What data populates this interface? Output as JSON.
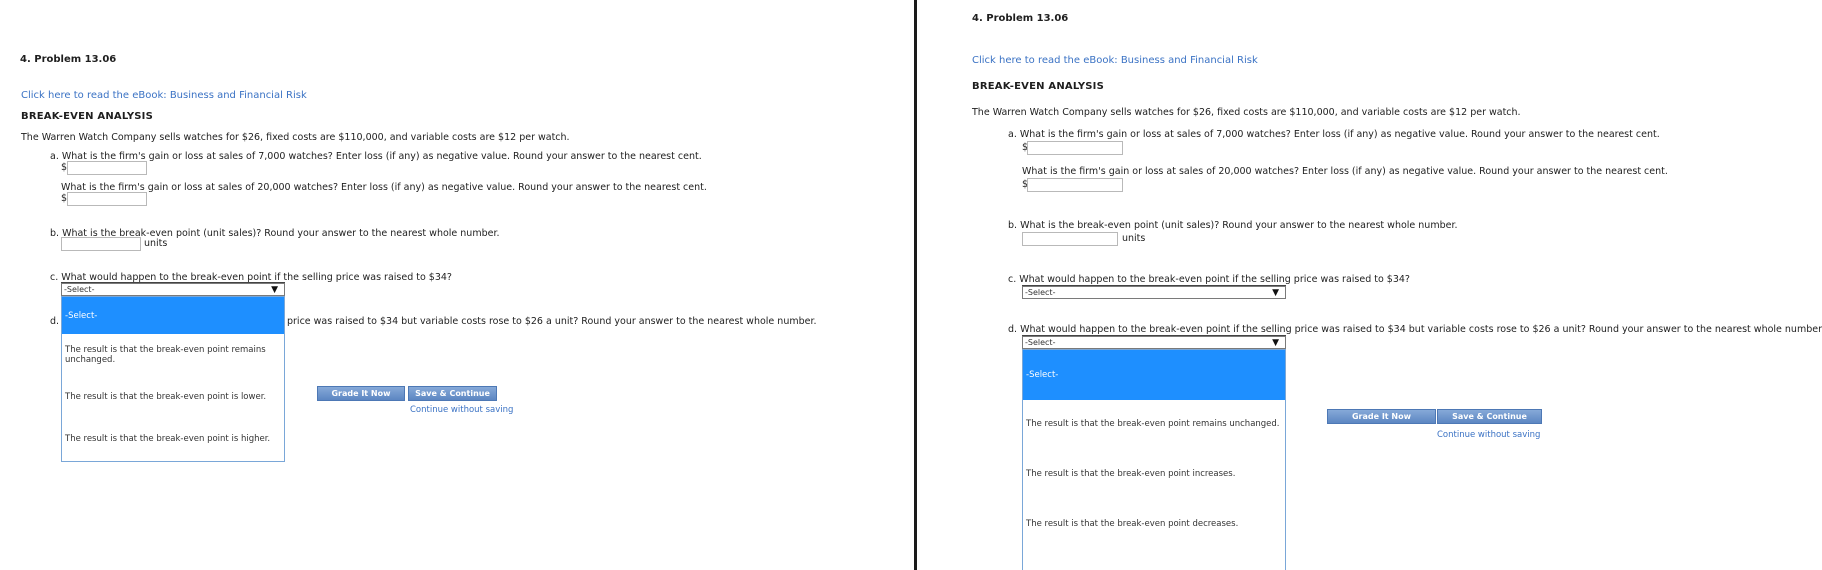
{
  "problem": {
    "number_title": "4.  Problem 13.06",
    "ebook_link": "Click here to read the eBook: Business and Financial Risk",
    "section_heading": "BREAK-EVEN ANALYSIS",
    "intro": "The Warren Watch Company sells watches for $26, fixed costs are $110,000, and variable costs are $12 per watch.",
    "qa1": "a. What is the firm's gain or loss at sales of 7,000 watches? Enter loss (if any) as negative value. Round your answer to the nearest cent.",
    "qa2": "What is the firm's gain or loss at sales of 20,000 watches? Enter loss (if any) as negative value. Round your answer to the nearest cent.",
    "currency": "$",
    "qb": "b. What is the break-even point (unit sales)? Round your answer to the nearest whole number.",
    "units_label": "units",
    "qc": "c. What would happen to the break-even point if the selling price was raised to $34?",
    "qd": "d. What would happen to the break-even point if the selling price was raised to $34 but variable costs rose to $26 a unit? Round your answer to the nearest whole number.",
    "qd_letter": "d.",
    "qd_tail": "price was raised to $34 but variable costs rose to $26 a unit? Round your answer to the nearest whole number.",
    "select_placeholder": "-Select-",
    "arrow_glyph": "▼"
  },
  "left_dropdown": {
    "options": [
      "-Select-",
      "The result is that the break-even point remains unchanged.",
      "The result is that the break-even point is lower.",
      "The result is that the break-even point is higher."
    ],
    "selected_index": 0
  },
  "right_dropdown": {
    "options": [
      "-Select-",
      "The result is that the break-even point remains unchanged.",
      "The result is that the break-even point increases.",
      "The result is that the break-even point decreases."
    ],
    "selected_index": 0
  },
  "actions": {
    "grade_label": "Grade It Now",
    "save_label": "Save & Continue",
    "continue_label": "Continue without saving"
  }
}
